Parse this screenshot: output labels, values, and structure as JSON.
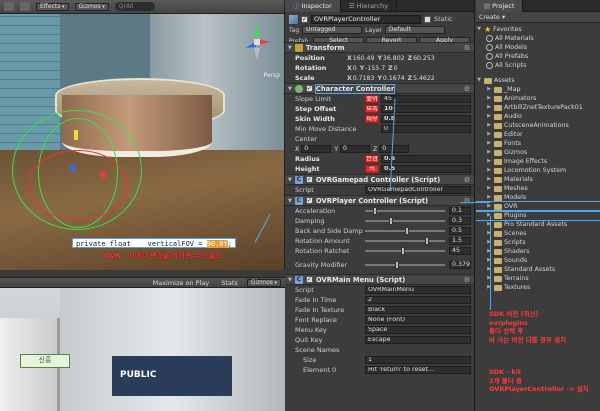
{
  "scene": {
    "toolbar": {
      "effects": "Effects",
      "gizmos": "Gizmos",
      "search": "QrAll"
    },
    "persp": "Persp",
    "code_text": "private float    verticalFOV = ",
    "code_value": "90.0f",
    "code_end": ";",
    "annotation": "OVR - 시야각 변경을 하려면 수정 필요"
  },
  "game": {
    "bar": {
      "maximize": "Maximize on Play",
      "stats": "Stats",
      "gizmos": "Gizmos"
    },
    "sign_text": "신흥",
    "board_text": "PUBLIC"
  },
  "inspector": {
    "tabs": [
      "Inspector",
      "Hierarchy"
    ],
    "object_name": "OVRPlayerController",
    "static_label": "Static",
    "tag_label": "Tag",
    "tag_value": "Untagged",
    "layer_label": "Layer",
    "layer_value": "Default",
    "prefab_label": "Prefab",
    "prefab_buttons": [
      "Select",
      "Revert",
      "Apply"
    ],
    "transform": {
      "title": "Transform",
      "position_label": "Position",
      "position": {
        "x": "160.49",
        "y": "36.802",
        "z": "60.253"
      },
      "rotation_label": "Rotation",
      "rotation": {
        "x": "0",
        "y": "-155.7",
        "z": "0"
      },
      "scale_label": "Scale",
      "scale": {
        "x": "0.7183",
        "y": "0.1674",
        "z": "5.4622"
      }
    },
    "character_controller": {
      "title": "Character Controller",
      "slope_limit_label": "Slope Limit",
      "slope_limit": "45",
      "step_offset_label": "Step Offset",
      "step_offset": "10",
      "skin_width_label": "Skin Width",
      "skin_width": "0.8",
      "min_move_label": "Min Move Distance",
      "min_move": "0",
      "center_label": "Center",
      "center": {
        "x": "0",
        "y": "0",
        "z": "0"
      },
      "radius_label": "Radius",
      "radius": "0.6",
      "height_label": "Height",
      "height": "0.5",
      "badge_slope": "높이",
      "badge_step": "보폭",
      "badge_skin": "피부",
      "badge_radius": "반경",
      "badge_height": "키"
    },
    "ovr_gamepad": {
      "title": "OVRGamepad Controller (Script)",
      "script_label": "Script",
      "script_value": "OVRGamepadController"
    },
    "ovr_player": {
      "title": "OVRPlayer Controller (Script)",
      "rows": [
        {
          "label": "Acceleration",
          "value": "0.1",
          "fill": 0.1
        },
        {
          "label": "Damping",
          "value": "0.3",
          "fill": 0.3
        },
        {
          "label": "Back and Side Damp",
          "value": "0.5",
          "fill": 0.5
        },
        {
          "label": "Rotation Amount",
          "value": "1.5",
          "fill": 0.75
        },
        {
          "label": "Rotation Ratchet",
          "value": "45",
          "fill": 0.45
        }
      ],
      "gravity_label": "Gravity Modifier",
      "gravity_value": "0.379",
      "gravity_fill": 0.38
    },
    "ovr_main_menu": {
      "title": "OVRMain Menu (Script)",
      "script_label": "Script",
      "script_value": "OVRMainMenu",
      "fade_in_time_label": "Fade In Time",
      "fade_in_time": "2",
      "fade_in_texture_label": "Fade In Texture",
      "fade_in_texture": "Black",
      "font_replace_label": "Font Replace",
      "font_replace": "None (Font)",
      "menu_key_label": "Menu Key",
      "menu_key": "Space",
      "quit_key_label": "Quit Key",
      "quit_key": "Escape",
      "scene_names_label": "Scene Names",
      "size_label": "Size",
      "size": "1",
      "element0_label": "Element 0",
      "element0": "Hit 'return' to reset..."
    }
  },
  "project": {
    "tab": "Project",
    "create": "Create",
    "favorites_label": "Favorites",
    "favorites": [
      "All Materials",
      "All Models",
      "All Prefabs",
      "All Scripts"
    ],
    "assets_label": "Assets",
    "folders": [
      "_Map",
      "Animators",
      "ArtbillZnetTexturePack01",
      "Audio",
      "CutsceneAnimations",
      "Editor",
      "Fonts",
      "Gizmos",
      "Image Effects",
      "Locomotion System",
      "Materials",
      "Meshes",
      "Models",
      "OVR",
      "Plugins",
      "Pro Standard Assets",
      "Scenes",
      "Scripts",
      "Shaders",
      "Sounds",
      "Standard Assets",
      "Terrains",
      "Textures"
    ],
    "note1": [
      "SDK 버전 (최신)",
      "ovrplugins",
      "폴더 선택 후",
      "바 사는 버전 다를 경우 설치"
    ],
    "note2": [
      "SDK - kit",
      "2개 폴더 중",
      "OVRPlayerController -> 설치"
    ]
  },
  "colors": {
    "accent": "#4fa8e8",
    "annotation": "#ff3a3a",
    "badge": "#d93030"
  }
}
